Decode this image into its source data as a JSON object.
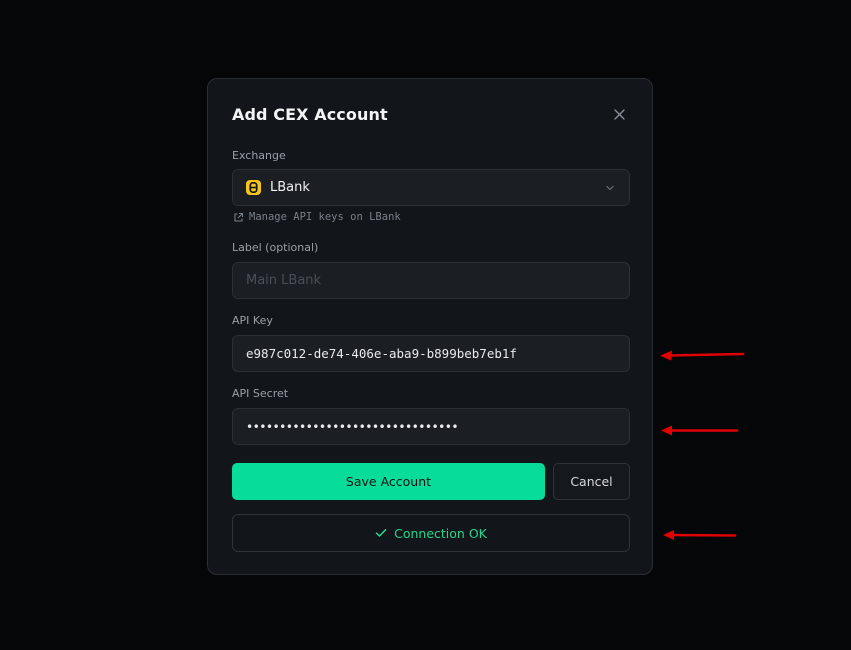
{
  "modal": {
    "title": "Add CEX Account"
  },
  "exchange": {
    "label": "Exchange",
    "selected": "LBank",
    "manage_link": "Manage API keys on LBank"
  },
  "label_field": {
    "label": "Label (optional)",
    "placeholder": "Main LBank"
  },
  "api_key": {
    "label": "API Key",
    "value": "e987c012-de74-406e-aba9-b899beb7eb1f"
  },
  "api_secret": {
    "label": "API Secret",
    "masked_value": "••••••••••••••••••••••••••••••••"
  },
  "actions": {
    "save_label": "Save Account",
    "cancel_label": "Cancel"
  },
  "status": {
    "text": "Connection OK"
  },
  "icons": {
    "close": "close-icon",
    "exchange_logo": "lbank-logo-icon",
    "chevron": "chevron-down-icon",
    "external_link": "external-link-icon",
    "check": "check-icon",
    "annotation_arrow": "red-arrow-icon"
  },
  "colors": {
    "background": "#050608",
    "modal": "#121519",
    "accent": "#08dc9a",
    "success_text": "#22d88f",
    "annotation": "#e00000",
    "logo": "#f5c518"
  }
}
